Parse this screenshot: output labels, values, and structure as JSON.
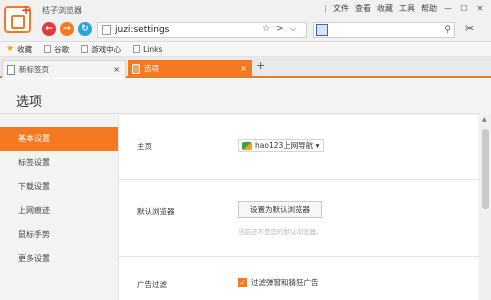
{
  "app_title": "桔子浏览器",
  "menu": {
    "items": [
      "文件",
      "查看",
      "收藏",
      "工具",
      "帮助"
    ],
    "separator": "|",
    "minimize": "—",
    "maximize": "☐",
    "close": "✕"
  },
  "nav": {
    "back": "←",
    "forward": "→",
    "refresh": "↻"
  },
  "address": {
    "url": "juzi:settings",
    "star": "☆",
    "chevron": ">",
    "dropdown": "⌵"
  },
  "search": {
    "button": "⚲"
  },
  "cut_icon": "✂",
  "bookmarks": [
    {
      "label": "收藏",
      "icon": "star-icon"
    },
    {
      "label": "谷歌",
      "icon": "page-icon"
    },
    {
      "label": "游戏中心",
      "icon": "game-icon"
    },
    {
      "label": "Links",
      "icon": "folder-icon"
    }
  ],
  "tabs": [
    {
      "label": "新标签页",
      "close": "×",
      "active": false
    },
    {
      "label": "选项",
      "close": "×",
      "active": true
    }
  ],
  "new_tab": "+",
  "page": {
    "title": "选项",
    "sidebar": [
      {
        "label": "基本设置",
        "active": true
      },
      {
        "label": "标签设置",
        "active": false
      },
      {
        "label": "下载设置",
        "active": false
      },
      {
        "label": "上网痕迹",
        "active": false
      },
      {
        "label": "鼠标手势",
        "active": false
      },
      {
        "label": "更多设置",
        "active": false
      }
    ],
    "homepage": {
      "label": "主页",
      "value": "hao123上网导航",
      "arrow": "▾"
    },
    "default_browser": {
      "label": "默认浏览器",
      "button": "设置为默认浏览器",
      "hint": "当前还不是您的默认浏览器。"
    },
    "ads": {
      "label": "广告过滤",
      "checkbox": "过滤弹窗和猜狂广告",
      "checked": true,
      "check_mark": "✓"
    }
  },
  "colors": {
    "accent": "#f47920",
    "back": "#e4393c",
    "refresh": "#29a3d8"
  }
}
